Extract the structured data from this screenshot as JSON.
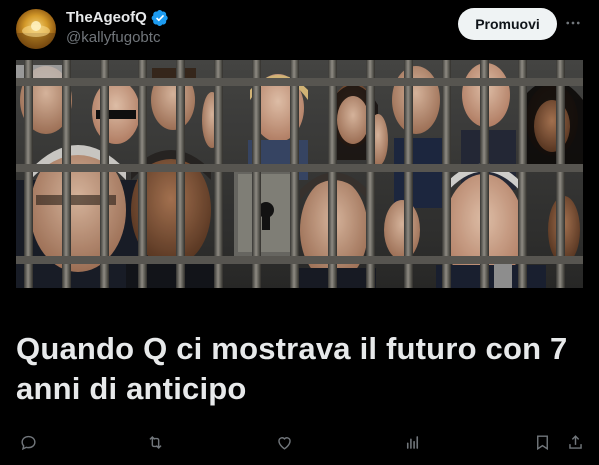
{
  "author": {
    "display_name": "TheAgeofQ",
    "handle": "@kallyfugobtc",
    "verified": true,
    "avatar_icon": "avatar-image"
  },
  "header": {
    "promote_label": "Promuovi",
    "more_icon": "more-icon"
  },
  "media": {
    "description_icon": "jail-bars-image"
  },
  "post": {
    "text": "Quando Q ci mostrava il futuro con 7 anni di anticipo"
  },
  "actions": [
    {
      "name": "reply-icon"
    },
    {
      "name": "repost-icon"
    },
    {
      "name": "like-icon"
    },
    {
      "name": "views-icon"
    },
    {
      "name": "bookmark-icon"
    },
    {
      "name": "share-icon"
    }
  ],
  "colors": {
    "background": "#000000",
    "text_primary": "#e7e9ea",
    "text_secondary": "#71767b",
    "verified_blue": "#1d9bf0",
    "button_bg": "#eff3f4"
  }
}
